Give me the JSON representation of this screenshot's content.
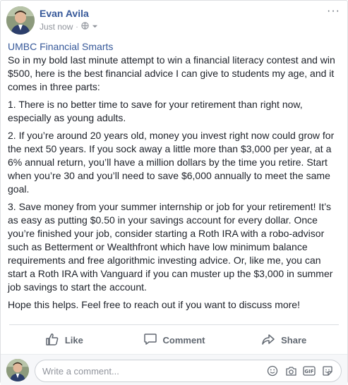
{
  "post": {
    "author": "Evan Avila",
    "timestamp": "Just now",
    "privacy_icon": "globe-icon",
    "more_label": "···",
    "group_link": "UMBC Financial Smarts",
    "paragraphs": [
      "So in my bold last minute attempt to win a financial literacy contest and win $500, here is the best financial advice I can give to students my age, and it comes in three parts:",
      "1. There is no better time to save for your retirement than right now, especially as young adults.",
      "2. If you’re around 20 years old, money you invest right now could grow for the next 50 years. If you sock away a little more than $3,000 per year, at a 6% annual return, you’ll have a million dollars by the time you retire. Start when you’re 30 and you’ll need to save $6,000 annually to meet the same goal.",
      "3. Save money from your summer internship or job for your retirement! It’s as easy as putting $0.50 in your savings account for every dollar. Once you’re finished your job, consider starting a Roth IRA with a robo-advisor such as Betterment or Wealthfront which have low minimum balance requirements and free algorithmic investing advice. Or, like me, you can start a Roth IRA with Vanguard if you can muster up the $3,000 in summer job savings to start the account.",
      "Hope this helps. Feel free to reach out if you want to discuss more!"
    ]
  },
  "actions": {
    "like": "Like",
    "comment": "Comment",
    "share": "Share"
  },
  "comment_box": {
    "placeholder": "Write a comment...",
    "icons": [
      "smiley-icon",
      "camera-icon",
      "gif-icon",
      "sticker-icon"
    ]
  }
}
